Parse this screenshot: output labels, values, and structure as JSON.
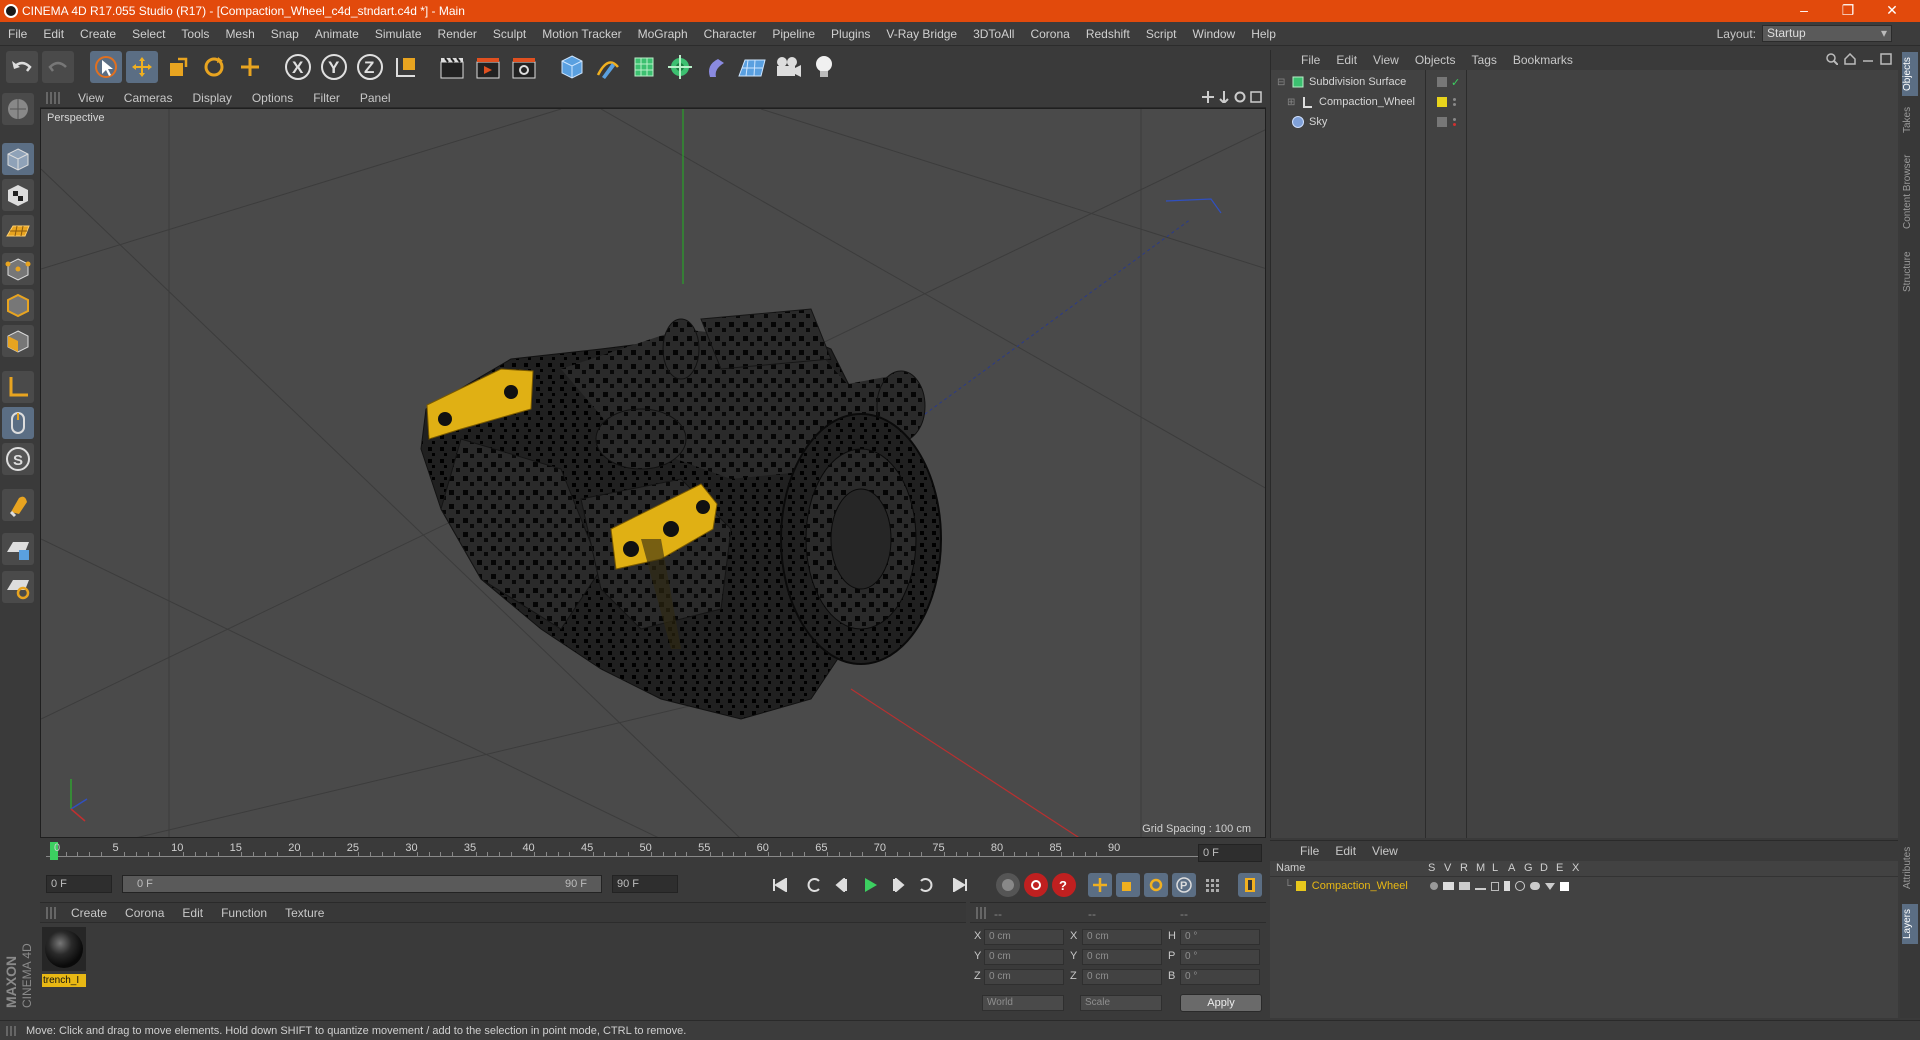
{
  "window": {
    "title": "CINEMA 4D R17.055 Studio (R17) - [Compaction_Wheel_c4d_stndart.c4d *] - Main",
    "minimize": "–",
    "restore": "❐",
    "close": "✕"
  },
  "menu": [
    "File",
    "Edit",
    "Create",
    "Select",
    "Tools",
    "Mesh",
    "Snap",
    "Animate",
    "Simulate",
    "Render",
    "Sculpt",
    "Motion Tracker",
    "MoGraph",
    "Character",
    "Pipeline",
    "Plugins",
    "V-Ray Bridge",
    "3DToAll",
    "Corona",
    "Redshift",
    "Script",
    "Window",
    "Help"
  ],
  "layout": {
    "label": "Layout:",
    "value": "Startup"
  },
  "viewport": {
    "menu": [
      "View",
      "Cameras",
      "Display",
      "Options",
      "Filter",
      "Panel"
    ],
    "label": "Perspective",
    "grid_spacing": "Grid Spacing : 100 cm"
  },
  "timeline": {
    "ticks": [
      "0",
      "5",
      "10",
      "15",
      "20",
      "25",
      "30",
      "35",
      "40",
      "45",
      "50",
      "55",
      "60",
      "65",
      "70",
      "75",
      "80",
      "85",
      "90"
    ],
    "current_frame": "0 F",
    "start": "0 F",
    "range_start": "0 F",
    "range_end": "90 F",
    "end": "90 F"
  },
  "material_panel": {
    "menu": [
      "Create",
      "Corona",
      "Edit",
      "Function",
      "Texture"
    ],
    "material_name": "trench_I"
  },
  "coord_panel": {
    "headers": [
      "--",
      "--",
      "--"
    ],
    "rows": [
      {
        "a": "X",
        "av": "0 cm",
        "b": "X",
        "bv": "0 cm",
        "c": "H",
        "cv": "0 °"
      },
      {
        "a": "Y",
        "av": "0 cm",
        "b": "Y",
        "bv": "0 cm",
        "c": "P",
        "cv": "0 °"
      },
      {
        "a": "Z",
        "av": "0 cm",
        "b": "Z",
        "bv": "0 cm",
        "c": "B",
        "cv": "0 °"
      }
    ],
    "space": "World",
    "mode": "Scale",
    "apply": "Apply"
  },
  "object_manager": {
    "menu": [
      "File",
      "Edit",
      "View",
      "Objects",
      "Tags",
      "Bookmarks"
    ],
    "objects": [
      {
        "name": "Subdivision Surface",
        "color": "#5fd35f"
      },
      {
        "name": "Compaction_Wheel",
        "color": "#e8e8e8"
      },
      {
        "name": "Sky",
        "color": "#7fa0d8"
      }
    ]
  },
  "layer_manager": {
    "menu": [
      "File",
      "Edit",
      "View"
    ],
    "columns": [
      "Name",
      "S",
      "V",
      "R",
      "M",
      "L",
      "A",
      "G",
      "D",
      "E",
      "X"
    ],
    "layer": {
      "name": "Compaction_Wheel",
      "color": "#e8c81c"
    }
  },
  "side_tabs": [
    "Objects",
    "Takes",
    "Content Browser",
    "Structure",
    "Attributes",
    "Layers"
  ],
  "branding": {
    "line1": "MAXON",
    "line2": "CINEMA 4D"
  },
  "status": "Move: Click and drag to move elements. Hold down SHIFT to quantize movement / add to the selection in point mode, CTRL to remove.",
  "colors": {
    "titlebar": "#e24a0c",
    "accent": "#5b6e84",
    "yellow": "#e8b814"
  }
}
